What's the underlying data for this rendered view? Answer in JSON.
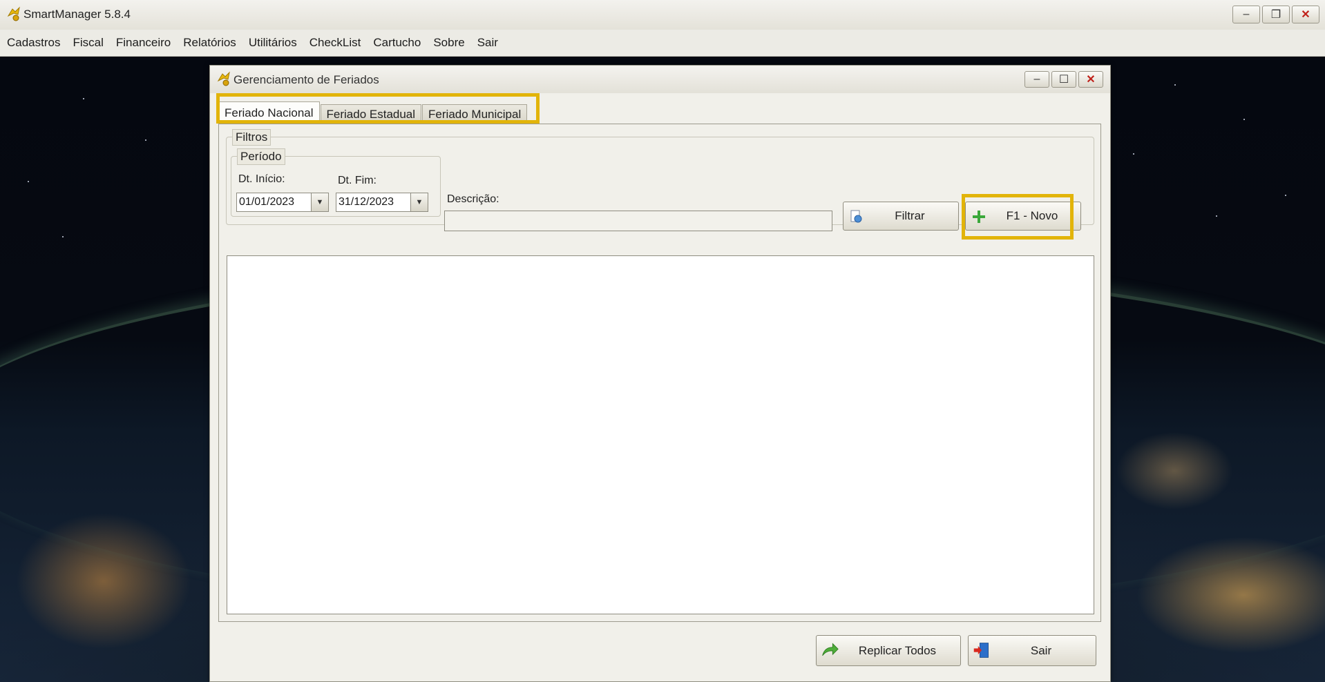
{
  "app": {
    "title": "SmartManager 5.8.4",
    "window_buttons": {
      "minimize": "–",
      "maximize": "❐",
      "close": "✕"
    }
  },
  "menu": [
    "Cadastros",
    "Fiscal",
    "Financeiro",
    "Relatórios",
    "Utilitários",
    "CheckList",
    "Cartucho",
    "Sobre",
    "Sair"
  ],
  "dialog": {
    "title": "Gerenciamento de Feriados",
    "window_buttons": {
      "minimize": "–",
      "maximize": "☐",
      "close": "✕"
    },
    "tabs": [
      "Feriado Nacional",
      "Feriado Estadual",
      "Feriado Municipal"
    ],
    "active_tab": "Feriado Nacional",
    "filters": {
      "group_label": "Filtros",
      "period": {
        "group_label": "Período",
        "start_label": "Dt. Início:",
        "start_value": "01/01/2023",
        "end_label": "Dt. Fim:",
        "end_value": "31/12/2023"
      },
      "description_label": "Descrição:",
      "description_value": "",
      "filter_button": "Filtrar",
      "new_button": "F1 - Novo"
    },
    "footer": {
      "replicate_button": "Replicar Todos",
      "exit_button": "Sair"
    }
  },
  "colors": {
    "highlight": "#e2b409",
    "dialog_bg": "#f1f0ea"
  }
}
